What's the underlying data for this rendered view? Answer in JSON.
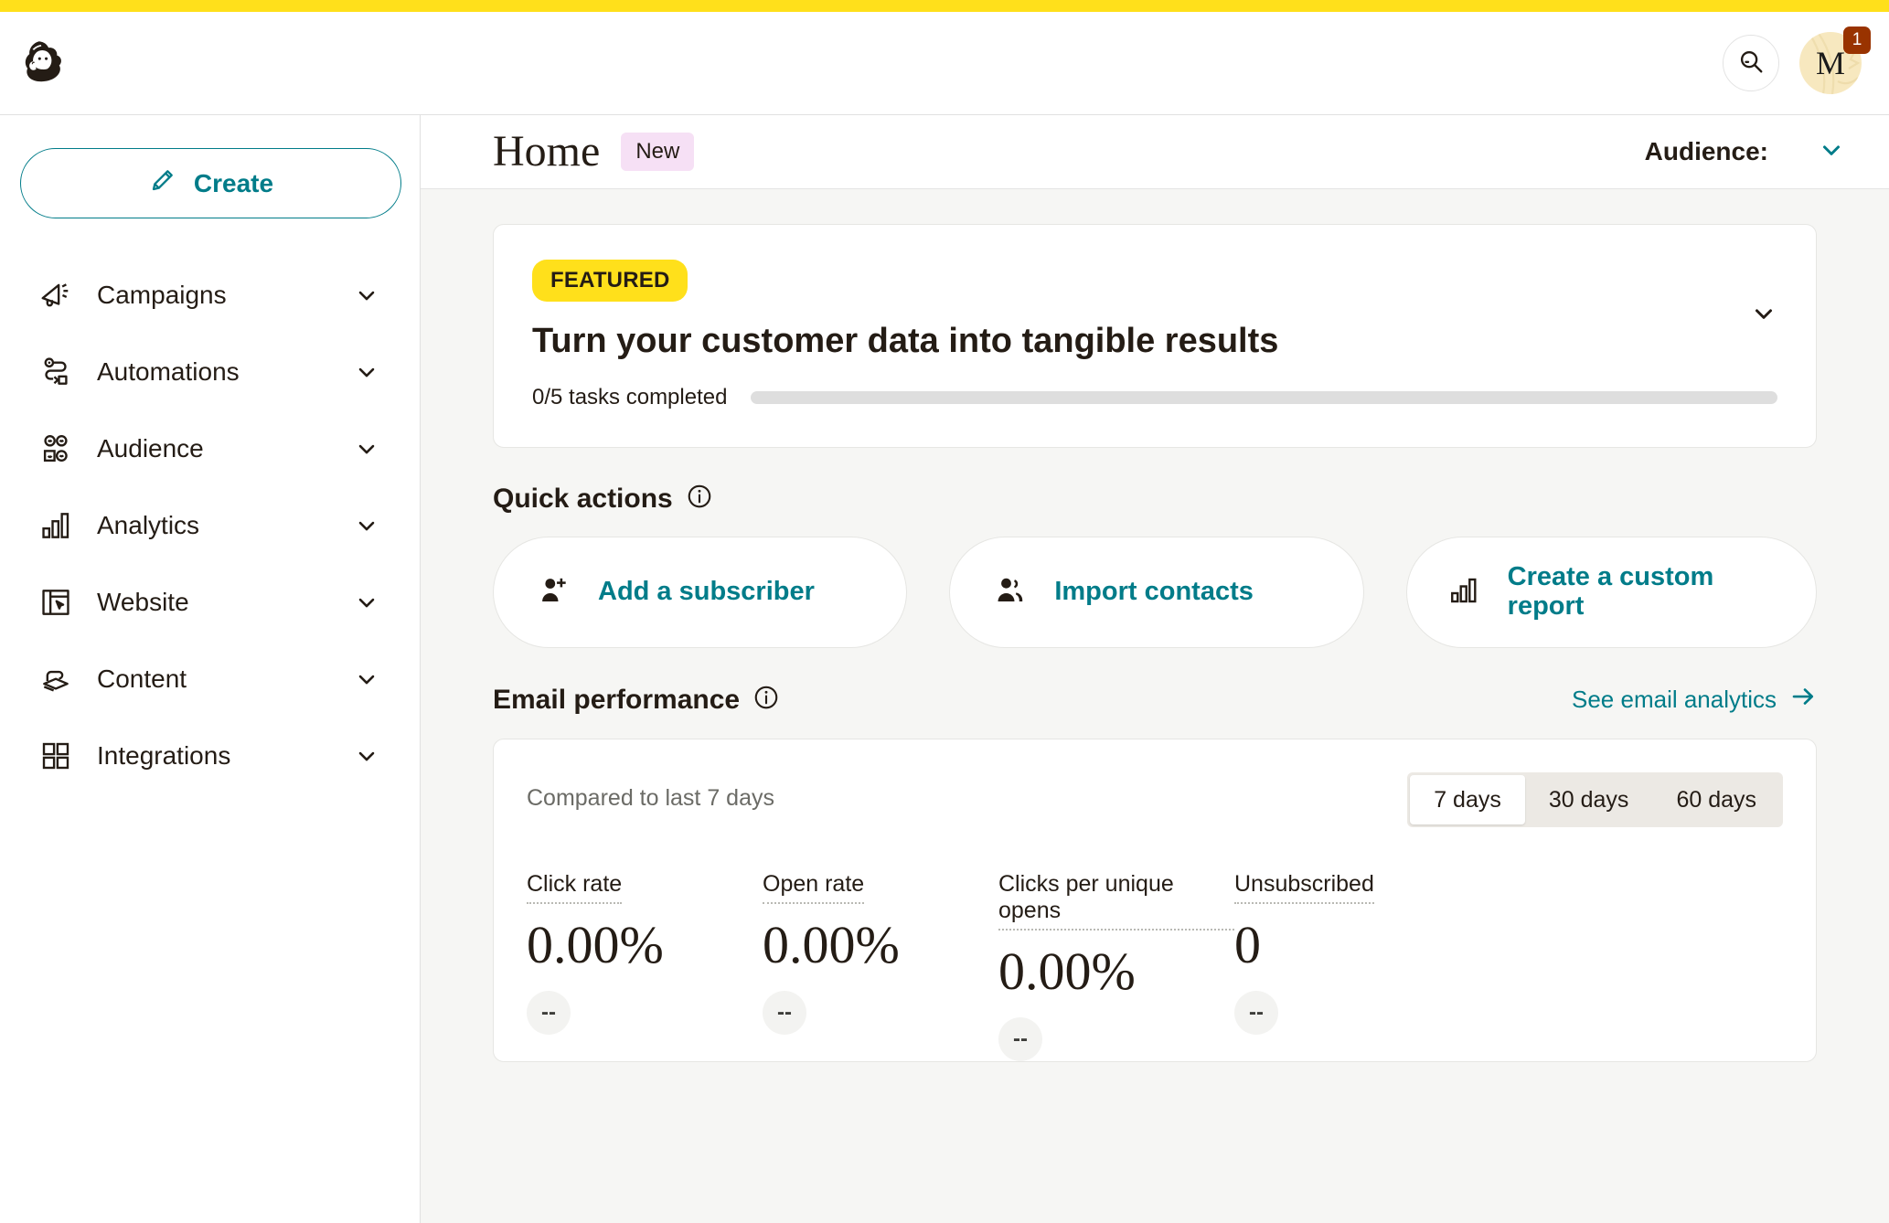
{
  "colors": {
    "brand_yellow": "#FFE01B",
    "brand_teal": "#007c89",
    "badge_red": "#993300",
    "pill_new_bg": "#f6e0f5",
    "page_bg": "#f6f6f4"
  },
  "topbar": {
    "logo_name": "mailchimp-logo",
    "search_icon": "search-icon",
    "avatar_initial": "M",
    "notification_count": "1"
  },
  "sidebar": {
    "create_label": "Create",
    "create_icon": "pencil-icon",
    "items": [
      {
        "label": "Campaigns",
        "icon": "megaphone-icon"
      },
      {
        "label": "Automations",
        "icon": "automation-path-icon"
      },
      {
        "label": "Audience",
        "icon": "people-group-icon"
      },
      {
        "label": "Analytics",
        "icon": "bar-chart-icon"
      },
      {
        "label": "Website",
        "icon": "website-cursor-icon"
      },
      {
        "label": "Content",
        "icon": "content-stack-icon"
      },
      {
        "label": "Integrations",
        "icon": "grid-squares-icon"
      }
    ]
  },
  "page_header": {
    "title": "Home",
    "badge": "New",
    "audience_label": "Audience:",
    "audience_value": "",
    "chevron_icon": "chevron-down-icon"
  },
  "featured": {
    "tag": "FEATURED",
    "title": "Turn your customer data into tangible results",
    "tasks_text": "0/5 tasks completed",
    "tasks_completed": 0,
    "tasks_total": 5,
    "progress_percent": 0,
    "collapse_icon": "chevron-down-icon"
  },
  "quick_actions": {
    "title": "Quick actions",
    "info_icon": "info-circle-icon",
    "cards": [
      {
        "label": "Add a subscriber",
        "icon": "user-plus-icon"
      },
      {
        "label": "Import contacts",
        "icon": "users-icon"
      },
      {
        "label": "Create a custom report",
        "icon": "bar-chart-icon"
      }
    ]
  },
  "email_performance": {
    "title": "Email performance",
    "info_icon": "info-circle-icon",
    "see_analytics_label": "See email analytics",
    "see_analytics_icon": "arrow-right-icon",
    "compared_text": "Compared to last 7 days",
    "ranges": [
      {
        "label": "7 days",
        "active": true
      },
      {
        "label": "30 days",
        "active": false
      },
      {
        "label": "60 days",
        "active": false
      }
    ],
    "metrics": [
      {
        "label": "Click rate",
        "value": "0.00%",
        "delta": "--"
      },
      {
        "label": "Open rate",
        "value": "0.00%",
        "delta": "--"
      },
      {
        "label": "Clicks per unique opens",
        "value": "0.00%",
        "delta": "--"
      },
      {
        "label": "Unsubscribed",
        "value": "0",
        "delta": "--"
      }
    ]
  }
}
